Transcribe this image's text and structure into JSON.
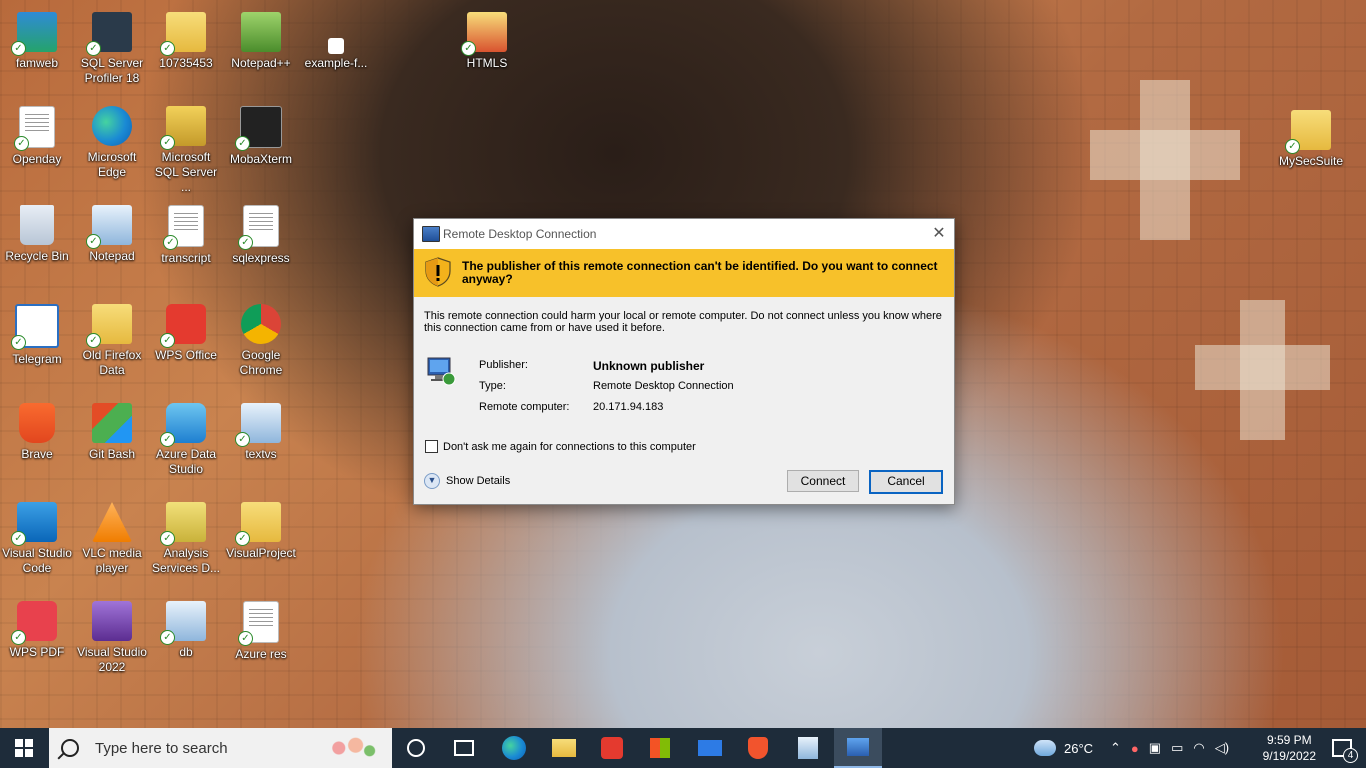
{
  "desktop": {
    "icons": [
      {
        "label": "famweb"
      },
      {
        "label": "SQL Server Profiler 18"
      },
      {
        "label": "10735453"
      },
      {
        "label": "Notepad++"
      },
      {
        "label": "example-f..."
      },
      {
        "label": "HTMLS"
      },
      {
        "label": "Openday"
      },
      {
        "label": "Microsoft Edge"
      },
      {
        "label": "Microsoft SQL Server ..."
      },
      {
        "label": "MobaXterm"
      },
      {
        "label": "MySecSuite"
      },
      {
        "label": "Recycle Bin"
      },
      {
        "label": "Notepad"
      },
      {
        "label": "transcript"
      },
      {
        "label": "sqlexpress"
      },
      {
        "label": "Telegram"
      },
      {
        "label": "Old Firefox Data"
      },
      {
        "label": "WPS Office"
      },
      {
        "label": "Google Chrome"
      },
      {
        "label": "Brave"
      },
      {
        "label": "Git Bash"
      },
      {
        "label": "Azure Data Studio"
      },
      {
        "label": "textvs"
      },
      {
        "label": "Visual Studio Code"
      },
      {
        "label": "VLC media player"
      },
      {
        "label": "Analysis Services D..."
      },
      {
        "label": "VisualProject"
      },
      {
        "label": "WPS PDF"
      },
      {
        "label": "Visual Studio 2022"
      },
      {
        "label": "db"
      },
      {
        "label": "Azure res"
      }
    ]
  },
  "dialog": {
    "title": "Remote Desktop Connection",
    "close_glyph": "✕",
    "warning": "The publisher of this remote connection can't be identified. Do you want to connect anyway?",
    "body": "This remote connection could harm your local or remote computer. Do not connect unless you know where this connection came from or have used it before.",
    "publisher_label": "Publisher:",
    "publisher_value": "Unknown publisher",
    "type_label": "Type:",
    "type_value": "Remote Desktop Connection",
    "remote_label": "Remote computer:",
    "remote_value": "20.171.94.183",
    "checkbox_label": "Don't ask me again for connections to this computer",
    "show_details": "Show Details",
    "connect": "Connect",
    "cancel": "Cancel"
  },
  "taskbar": {
    "search_placeholder": "Type here to search",
    "weather": "26°C",
    "time": "9:59 PM",
    "date": "9/19/2022",
    "notifications": "4",
    "accent": "#1e2c3a"
  }
}
